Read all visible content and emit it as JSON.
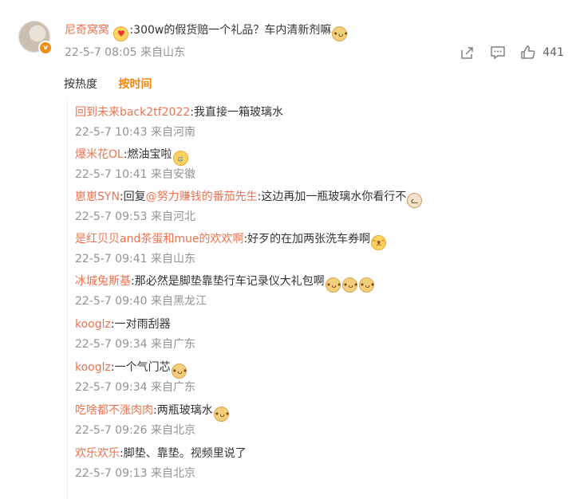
{
  "main_comment": {
    "username": "尼奇窝窝",
    "text": ":300w的假货赔一个礼品？车内清新剂嘛",
    "time": "22-5-7 08:05 来自山东",
    "like_count": "441",
    "emoji_lead": "love-eyes-emoji",
    "emoji_trail": "doge-emoji"
  },
  "sort": {
    "hot": "按热度",
    "time": "按时间",
    "active": "time"
  },
  "replies": [
    {
      "user": "回到未来back2tf2022",
      "text": ":我直接一箱玻璃水",
      "time": "22-5-7 10:43 来自河南",
      "emojis": []
    },
    {
      "user": "爆米花OL",
      "text": ":燃油宝啦",
      "time": "22-5-7 10:41 来自安徽",
      "emojis": [
        "cry-emoji"
      ]
    },
    {
      "user": "崽崽SYN",
      "reply_prefix": ":回复",
      "mention": "@努力赚钱的番茄先生",
      "text": ":这边再加一瓶玻璃水你看行不",
      "time": "22-5-7 09:53 来自河北",
      "emojis": [
        "cat-emoji"
      ]
    },
    {
      "user": "是红贝贝and茶蛋和mue的欢欢啊",
      "text": ":好歹的在加两张洗车券啊",
      "time": "22-5-7 09:41 来自山东",
      "emojis": [
        "laugh-emoji"
      ]
    },
    {
      "user": "冰城兔斯基",
      "text": ":那必然是脚垫靠垫行车记录仪大礼包啊",
      "time": "22-5-7 09:40 来自黑龙江",
      "emojis": [
        "doge-emoji",
        "doge-emoji",
        "doge-emoji"
      ]
    },
    {
      "user": "kooglz",
      "text": ":一对雨刮器",
      "time": "22-5-7 09:34 来自广东",
      "emojis": []
    },
    {
      "user": "kooglz",
      "text": ":一个气门芯",
      "time": "22-5-7 09:34 来自广东",
      "emojis": [
        "doge-emoji"
      ]
    },
    {
      "user": "吃啥都不涨肉肉",
      "text": ":两瓶玻璃水",
      "time": "22-5-7 09:26 来自北京",
      "emojis": [
        "doge-emoji"
      ]
    },
    {
      "user": "欢乐欢乐",
      "text": ":脚垫、靠垫。视频里说了",
      "time": "22-5-7 09:13 来自北京",
      "emojis": []
    }
  ],
  "colors": {
    "username": "#eb7350",
    "meta": "#939393",
    "sort_active": "#ff8200"
  }
}
